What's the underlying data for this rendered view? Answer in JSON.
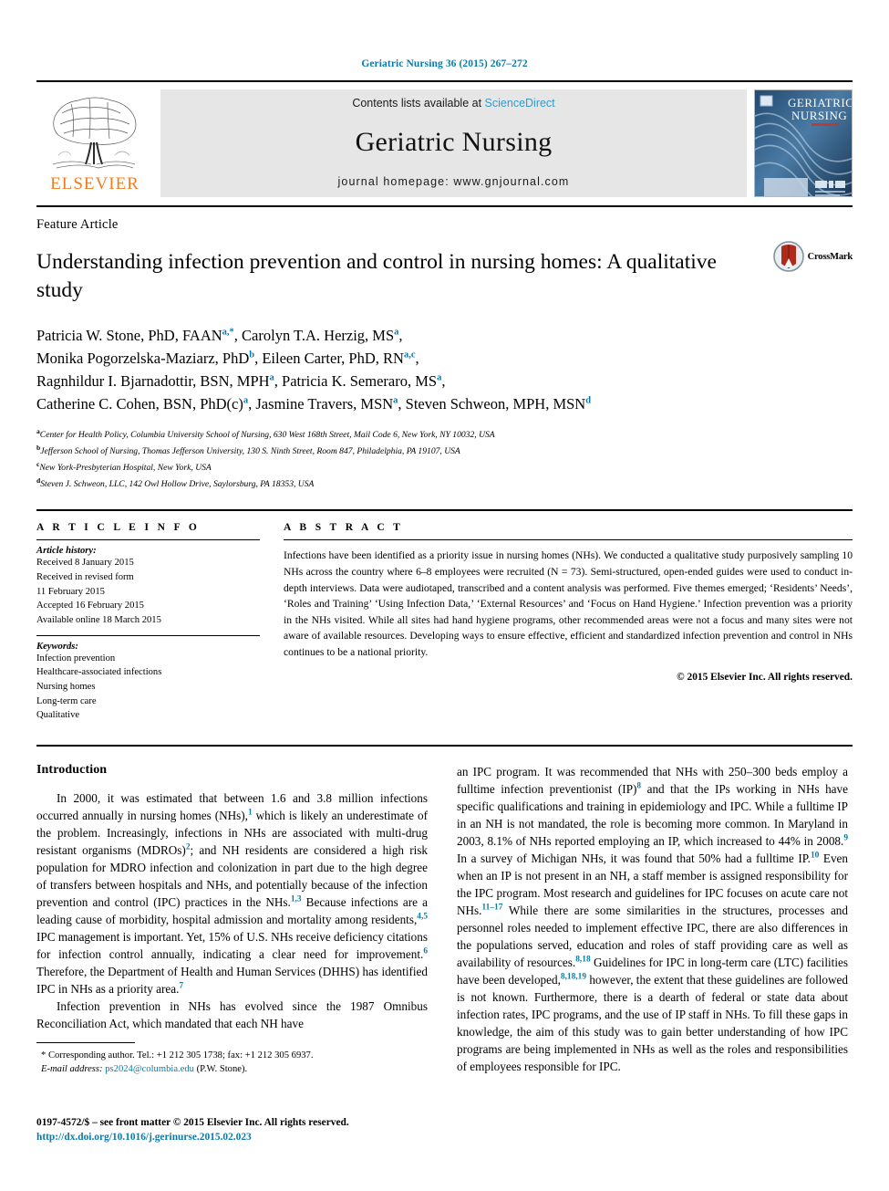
{
  "running_head": "Geriatric Nursing 36 (2015) 267–272",
  "masthead": {
    "publisher_logo_text": "ELSEVIER",
    "contents_prefix": "Contents lists available at",
    "contents_link": "ScienceDirect",
    "journal_title": "Geriatric Nursing",
    "homepage_line": "journal homepage: www.gnjournal.com",
    "cover_title_line1": "GERIATRIC",
    "cover_title_line2": "NURSING",
    "link_color": "#2e9bd0",
    "elsevier_orange": "#ef7d22"
  },
  "article": {
    "type_label": "Feature Article",
    "title": "Understanding infection prevention and control in nursing homes: A qualitative study",
    "crossmark_label": "CrossMark",
    "authors_html": "Patricia W. Stone, PhD, FAAN<sup class=\"aff\">a,*</sup>, Carolyn T.A. Herzig, MS<sup class=\"aff\">a</sup>,<br>Monika Pogorzelska-Maziarz, PhD<sup class=\"aff\">b</sup>, Eileen Carter, PhD, RN<sup class=\"aff\">a,c</sup>,<br>Ragnhildur I. Bjarnadottir, BSN, MPH<sup class=\"aff\">a</sup>, Patricia K. Semeraro, MS<sup class=\"aff\">a</sup>,<br>Catherine C. Cohen, BSN, PhD(c)<sup class=\"aff\">a</sup>, Jasmine Travers, MSN<sup class=\"aff\">a</sup>, Steven Schweon, MPH, MSN<sup class=\"aff\">d</sup>",
    "affiliations": [
      {
        "marker": "a",
        "text": "Center for Health Policy, Columbia University School of Nursing, 630 West 168th Street, Mail Code 6, New York, NY 10032, USA"
      },
      {
        "marker": "b",
        "text": "Jefferson School of Nursing, Thomas Jefferson University, 130 S. Ninth Street, Room 847, Philadelphia, PA 19107, USA"
      },
      {
        "marker": "c",
        "text": "New York-Presbyterian Hospital, New York, USA"
      },
      {
        "marker": "d",
        "text": "Steven J. Schweon, LLC, 142 Owl Hollow Drive, Saylorsburg, PA 18353, USA"
      }
    ]
  },
  "article_info": {
    "heading": "A R T I C L E  I N F O",
    "history_label": "Article history:",
    "history": [
      "Received 8 January 2015",
      "Received in revised form",
      "11 February 2015",
      "Accepted 16 February 2015",
      "Available online 18 March 2015"
    ],
    "keywords_label": "Keywords:",
    "keywords": [
      "Infection prevention",
      "Healthcare-associated infections",
      "Nursing homes",
      "Long-term care",
      "Qualitative"
    ]
  },
  "abstract": {
    "heading": "A B S T R A C T",
    "text": "Infections have been identified as a priority issue in nursing homes (NHs). We conducted a qualitative study purposively sampling 10 NHs across the country where 6–8 employees were recruited (N = 73). Semi-structured, open-ended guides were used to conduct in-depth interviews. Data were audiotaped, transcribed and a content analysis was performed. Five themes emerged; ‘Residents’ Needs’, ‘Roles and Training’ ‘Using Infection Data,’ ‘External Resources’ and ‘Focus on Hand Hygiene.’ Infection prevention was a priority in the NHs visited. While all sites had hand hygiene programs, other recommended areas were not a focus and many sites were not aware of available resources. Developing ways to ensure effective, efficient and standardized infection prevention and control in NHs continues to be a national priority.",
    "copyright": "© 2015 Elsevier Inc. All rights reserved."
  },
  "body": {
    "intro_heading": "Introduction",
    "left_paragraphs_html": [
      "In 2000, it was estimated that between 1.6 and 3.8 million infections occurred annually in nursing homes (NHs),<sup class=\"ref\">1</sup> which is likely an underestimate of the problem. Increasingly, infections in NHs are associated with multi-drug resistant organisms (MDROs)<sup class=\"ref\">2</sup>; and NH residents are considered a high risk population for MDRO infection and colonization in part due to the high degree of transfers between hospitals and NHs, and potentially because of the infection prevention and control (IPC) practices in the NHs.<sup class=\"ref\">1,3</sup> Because infections are a leading cause of morbidity, hospital admission and mortality among residents,<sup class=\"ref\">4,5</sup> IPC management is important. Yet, 15% of U.S. NHs receive deficiency citations for infection control annually, indicating a clear need for improvement.<sup class=\"ref\">6</sup> Therefore, the Department of Health and Human Services (DHHS) has identified IPC in NHs as a priority area.<sup class=\"ref\">7</sup>",
      "Infection prevention in NHs has evolved since the 1987 Omnibus Reconciliation Act, which mandated that each NH have"
    ],
    "right_paragraphs_html": [
      "an IPC program. It was recommended that NHs with 250–300 beds employ a fulltime infection preventionist (IP)<sup class=\"ref\">8</sup> and that the IPs working in NHs have specific qualifications and training in epidemiology and IPC. While a fulltime IP in an NH is not mandated, the role is becoming more common. In Maryland in 2003, 8.1% of NHs reported employing an IP, which increased to 44% in 2008.<sup class=\"ref\">9</sup> In a survey of Michigan NHs, it was found that 50% had a fulltime IP.<sup class=\"ref\">10</sup> Even when an IP is not present in an NH, a staff member is assigned responsibility for the IPC program. Most research and guidelines for IPC focuses on acute care not NHs.<sup class=\"ref\">11–17</sup> While there are some similarities in the structures, processes and personnel roles needed to implement effective IPC, there are also differences in the populations served, education and roles of staff providing care as well as availability of resources.<sup class=\"ref\">8,18</sup> Guidelines for IPC in long-term care (LTC) facilities have been developed,<sup class=\"ref\">8,18,19</sup> however, the extent that these guidelines are followed is not known. Furthermore, there is a dearth of federal or state data about infection rates, IPC programs, and the use of IP staff in NHs. To fill these gaps in knowledge, the aim of this study was to gain better understanding of how IPC programs are being implemented in NHs as well as the roles and responsibilities of employees responsible for IPC."
    ]
  },
  "footnotes": {
    "corresponding_html": "* Corresponding author. Tel.: +1 212 305 1738; fax: +1 212 305 6937.",
    "email_label": "E-mail address:",
    "email": "ps2024@columbia.edu",
    "email_suffix": "(P.W. Stone)."
  },
  "footer": {
    "issn_line": "0197-4572/$ – see front matter © 2015 Elsevier Inc. All rights reserved.",
    "doi": "http://dx.doi.org/10.1016/j.gerinurse.2015.02.023"
  }
}
